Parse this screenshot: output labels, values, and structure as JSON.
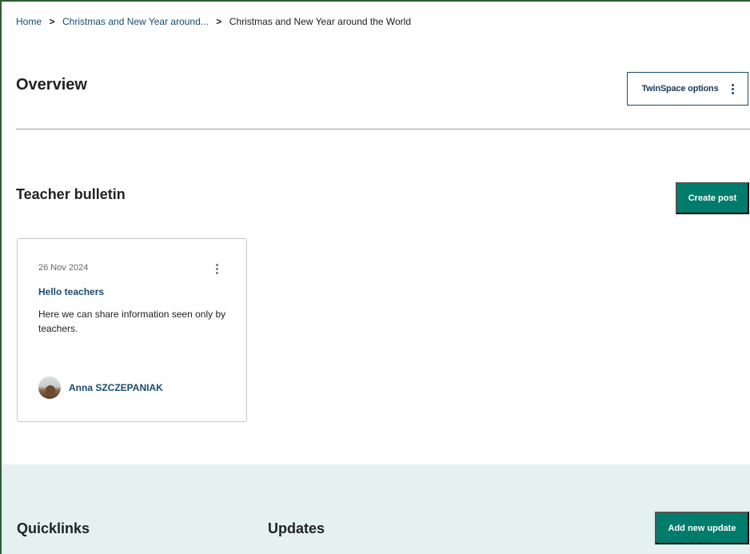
{
  "breadcrumb": {
    "items": [
      {
        "label": "Home"
      },
      {
        "label": "Christmas and New Year around..."
      },
      {
        "label": "Christmas and New Year around the World"
      }
    ],
    "separator": ">"
  },
  "page": {
    "title": "Overview",
    "twinspace_button": "TwinSpace options"
  },
  "bulletin": {
    "title": "Teacher bulletin",
    "create_button": "Create post",
    "posts": [
      {
        "date": "26 Nov 2024",
        "title": "Hello teachers",
        "body": "Here we can share information seen only by teachers.",
        "author": "Anna SZCZEPANIAK"
      }
    ]
  },
  "bottom": {
    "quicklinks_title": "Quicklinks",
    "updates_title": "Updates",
    "add_update_button": "Add new update"
  },
  "colors": {
    "accent_green": "#007c6c",
    "link_blue": "#1a4a6e",
    "band_bg": "#e4f1ef"
  },
  "icons": {
    "breadcrumb_separator": "chevron-right-icon",
    "options": "kebab-menu-icon",
    "post_options": "kebab-menu-icon",
    "avatar": "user-avatar"
  }
}
